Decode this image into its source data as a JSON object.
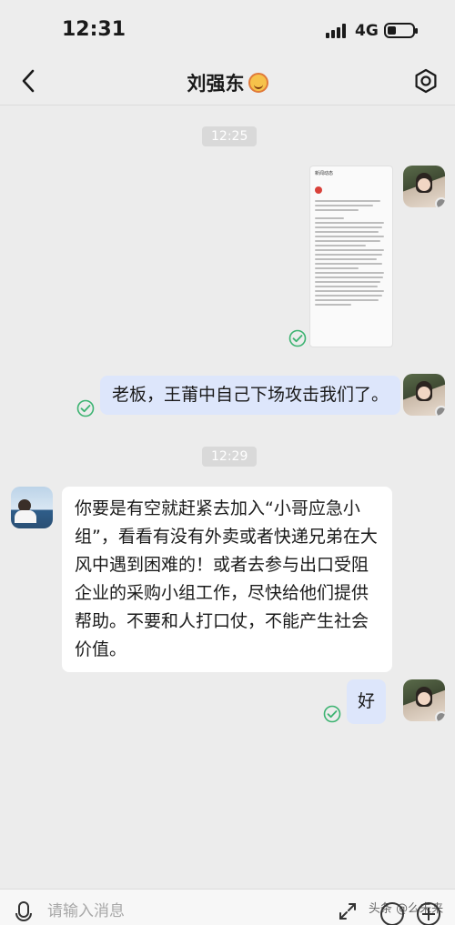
{
  "status_bar": {
    "time": "12:31",
    "network": "4G"
  },
  "header": {
    "title": "刘强东"
  },
  "messages": {
    "timestamp_1": "12:25",
    "image_title": "新闻动态",
    "text_1": "老板，王莆中自己下场攻击我们了。",
    "timestamp_2": "12:29",
    "text_2": "你要是有空就赶紧去加入“小哥应急小组”，看看有没有外卖或者快递兄弟在大风中遇到困难的！或者去参与出口受阻企业的采购小组工作，尽快给他们提供帮助。不要和人打口仗，不能产生社会价值。",
    "text_3": "好"
  },
  "input": {
    "placeholder": "请输入消息"
  },
  "watermark": "头条 @么未来"
}
